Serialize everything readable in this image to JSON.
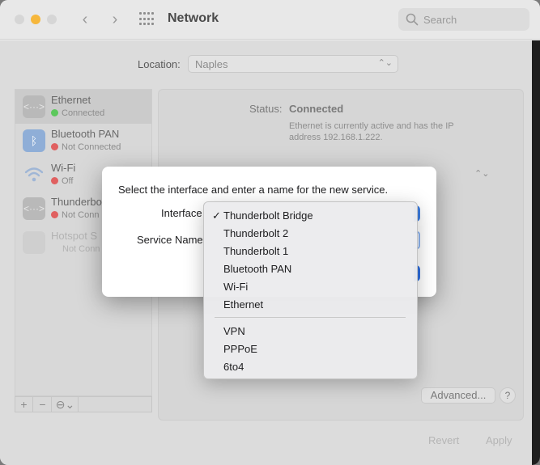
{
  "window": {
    "title": "Network"
  },
  "search": {
    "placeholder": "Search"
  },
  "location": {
    "label": "Location:",
    "value": "Naples"
  },
  "services": [
    {
      "name": "Ethernet",
      "status": "Connected",
      "status_color": "#5cc85c"
    },
    {
      "name": "Bluetooth PAN",
      "status": "Not Connected",
      "status_color": "#e06060"
    },
    {
      "name": "Wi-Fi",
      "status": "Off",
      "status_color": "#e06060"
    },
    {
      "name": "Thunderbo",
      "status": "Not Conn",
      "status_color": "#e06060"
    },
    {
      "name": "Hotspot S",
      "status": "Not Conn",
      "status_color": ""
    }
  ],
  "detail": {
    "status_label": "Status:",
    "status_value": "Connected",
    "status_desc": "Ethernet is currently active and has the IP address 192.168.1.222.",
    "advanced_label": "Advanced...",
    "help_label": "?",
    "revert_label": "Revert",
    "apply_label": "Apply"
  },
  "toolbar": {
    "add": "+",
    "remove": "−",
    "action": "⊖⌄"
  },
  "sheet": {
    "prompt": "Select the interface and enter a name for the new service.",
    "interface_label": "Interface",
    "service_name_label": "Service Name"
  },
  "menu": {
    "selected": "Thunderbolt Bridge",
    "items": [
      "Thunderbolt Bridge",
      "Thunderbolt 2",
      "Thunderbolt 1",
      "Bluetooth PAN",
      "Wi-Fi",
      "Ethernet"
    ],
    "items2": [
      "VPN",
      "PPPoE",
      "6to4"
    ]
  },
  "colors": {
    "accent": "#2f6fe0"
  },
  "icons": {
    "ethernet": "<···>",
    "bluetooth": "ᛒ",
    "wifi": "wifi-icon"
  }
}
